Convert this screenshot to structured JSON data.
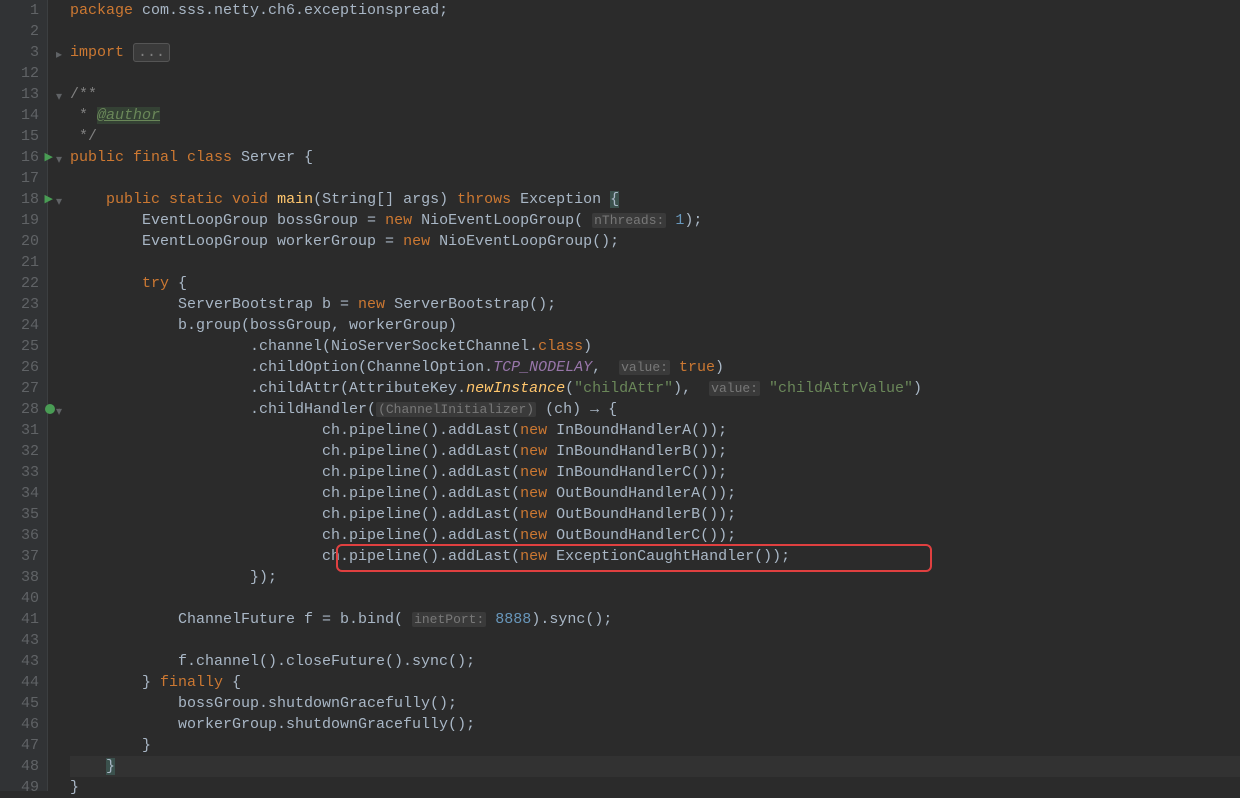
{
  "lines": [
    {
      "n": 1,
      "fold": "",
      "marker": "",
      "html": "<span class='kw'>package</span> com.sss.netty.ch6.exceptionspread;"
    },
    {
      "n": 2,
      "fold": "",
      "marker": "",
      "html": ""
    },
    {
      "n": 3,
      "fold": "+",
      "marker": "",
      "html": "<span class='kw'>import</span> <span class='fold-collapsed'>...</span>"
    },
    {
      "n": 12,
      "fold": "",
      "marker": "",
      "html": ""
    },
    {
      "n": 13,
      "fold": "-",
      "marker": "",
      "html": "<span class='cmt'>/**</span>"
    },
    {
      "n": 14,
      "fold": "",
      "marker": "",
      "html": "<span class='cmt'> * </span><span class='ann'>@author</span>"
    },
    {
      "n": 15,
      "fold": "",
      "marker": "",
      "html": "<span class='cmt'> */</span>"
    },
    {
      "n": 16,
      "fold": "-",
      "marker": "run",
      "html": "<span class='kw'>public final class</span> Server {"
    },
    {
      "n": 17,
      "fold": "",
      "marker": "",
      "html": ""
    },
    {
      "n": 18,
      "fold": "-",
      "marker": "run",
      "html": "    <span class='kw'>public static void</span> <span class='fn'>main</span>(String[] args) <span class='kw'>throws</span> Exception <span class='paren-hl'>{</span>"
    },
    {
      "n": 19,
      "fold": "",
      "marker": "",
      "html": "        EventLoopGroup bossGroup = <span class='kw'>new</span> NioEventLoopGroup( <span class='hint'>nThreads:</span> <span class='num'>1</span>);"
    },
    {
      "n": 20,
      "fold": "",
      "marker": "",
      "html": "        EventLoopGroup workerGroup = <span class='kw'>new</span> NioEventLoopGroup();"
    },
    {
      "n": 21,
      "fold": "",
      "marker": "",
      "html": ""
    },
    {
      "n": 22,
      "fold": "",
      "marker": "",
      "html": "        <span class='kw'>try</span> {"
    },
    {
      "n": 23,
      "fold": "",
      "marker": "",
      "html": "            ServerBootstrap b = <span class='kw'>new</span> ServerBootstrap();"
    },
    {
      "n": 24,
      "fold": "",
      "marker": "",
      "html": "            b.group(bossGroup, workerGroup)"
    },
    {
      "n": 25,
      "fold": "",
      "marker": "",
      "html": "                    .channel(NioServerSocketChannel.<span class='kw'>class</span>)"
    },
    {
      "n": 26,
      "fold": "",
      "marker": "",
      "html": "                    .childOption(ChannelOption.<span class='static-it'>TCP_NODELAY</span>,  <span class='hint'>value:</span> <span class='kw'>true</span>)"
    },
    {
      "n": 27,
      "fold": "",
      "marker": "",
      "html": "                    .childAttr(AttributeKey.<span class='static-fnit'>newInstance</span>(<span class='str'>\"childAttr\"</span>),  <span class='hint'>value:</span> <span class='str'>\"childAttrValue\"</span>)"
    },
    {
      "n": 28,
      "fold": "-",
      "marker": "bp",
      "html": "                    .childHandler(<span class='hint'>(ChannelInitializer)</span> (ch) → {"
    },
    {
      "n": 31,
      "fold": "",
      "marker": "",
      "html": "                            ch.pipeline().addLast(<span class='kw'>new</span> InBoundHandlerA());"
    },
    {
      "n": 32,
      "fold": "",
      "marker": "",
      "html": "                            ch.pipeline().addLast(<span class='kw'>new</span> InBoundHandlerB());"
    },
    {
      "n": 33,
      "fold": "",
      "marker": "",
      "html": "                            ch.pipeline().addLast(<span class='kw'>new</span> InBoundHandlerC());"
    },
    {
      "n": 34,
      "fold": "",
      "marker": "",
      "html": "                            ch.pipeline().addLast(<span class='kw'>new</span> OutBoundHandlerA());"
    },
    {
      "n": 35,
      "fold": "",
      "marker": "",
      "html": "                            ch.pipeline().addLast(<span class='kw'>new</span> OutBoundHandlerB());"
    },
    {
      "n": 36,
      "fold": "",
      "marker": "",
      "html": "                            ch.pipeline().addLast(<span class='kw'>new</span> OutBoundHandlerC());"
    },
    {
      "n": 37,
      "fold": "",
      "marker": "",
      "html": "                            ch.pipeline().addLast(<span class='kw'>new</span> ExceptionCaughtHandler());"
    },
    {
      "n": 38,
      "fold": "",
      "marker": "",
      "html": "                    });"
    },
    {
      "n": 40,
      "fold": "",
      "marker": "",
      "html": ""
    },
    {
      "n": 41,
      "fold": "",
      "marker": "",
      "html": "            ChannelFuture f = b.bind( <span class='hint'>inetPort:</span> <span class='num'>8888</span>).sync();"
    },
    {
      "n": 43,
      "fold": "",
      "marker": "",
      "html": ""
    },
    {
      "n": 43,
      "fold": "",
      "marker": "",
      "html": "            f.channel().closeFuture().sync();"
    },
    {
      "n": 44,
      "fold": "",
      "marker": "",
      "html": "        } <span class='kw'>finally</span> {"
    },
    {
      "n": 45,
      "fold": "",
      "marker": "",
      "html": "            bossGroup.shutdownGracefully();"
    },
    {
      "n": 46,
      "fold": "",
      "marker": "",
      "html": "            workerGroup.shutdownGracefully();"
    },
    {
      "n": 47,
      "fold": "",
      "marker": "",
      "html": "        }"
    },
    {
      "n": 48,
      "fold": "",
      "marker": "",
      "html": "    <span class='paren-hl'>}</span>",
      "caret": true
    },
    {
      "n": 49,
      "fold": "",
      "marker": "",
      "html": "}"
    }
  ],
  "highlight_box_line": 37
}
